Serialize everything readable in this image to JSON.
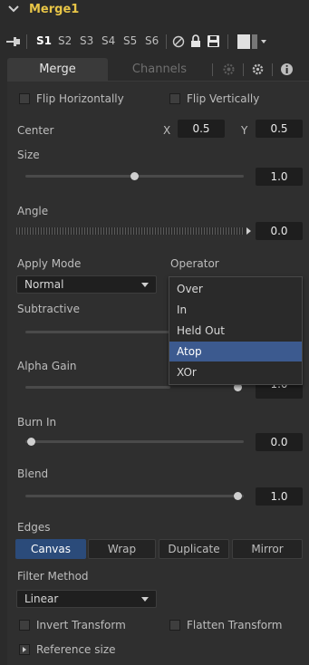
{
  "node": {
    "title": "Merge1"
  },
  "slots": {
    "items": [
      "S1",
      "S2",
      "S3",
      "S4",
      "S5",
      "S6"
    ],
    "active": "S1"
  },
  "tabs": {
    "merge": "Merge",
    "channels": "Channels"
  },
  "flip": {
    "horizontal": "Flip Horizontally",
    "vertical": "Flip Vertically"
  },
  "center": {
    "label": "Center",
    "x_label": "X",
    "x_value": "0.5",
    "y_label": "Y",
    "y_value": "0.5"
  },
  "size": {
    "label": "Size",
    "value": "1.0"
  },
  "angle": {
    "label": "Angle",
    "value": "0.0"
  },
  "apply_mode": {
    "label": "Apply Mode",
    "value": "Normal"
  },
  "operator": {
    "label": "Operator",
    "options": [
      "Over",
      "In",
      "Held Out",
      "Atop",
      "XOr"
    ],
    "highlighted": "Atop"
  },
  "subtractive": {
    "label": "Subtractive"
  },
  "alpha_gain": {
    "label": "Alpha Gain",
    "value": "1.0"
  },
  "burn_in": {
    "label": "Burn In",
    "value": "0.0"
  },
  "blend": {
    "label": "Blend",
    "value": "1.0"
  },
  "edges": {
    "label": "Edges",
    "options": [
      "Canvas",
      "Wrap",
      "Duplicate",
      "Mirror"
    ],
    "active": "Canvas"
  },
  "filter_method": {
    "label": "Filter Method",
    "value": "Linear"
  },
  "transform": {
    "invert": "Invert Transform",
    "flatten": "Flatten Transform"
  },
  "reference": {
    "label": "Reference size"
  },
  "colors": {
    "accent": "#e8c547",
    "selection": "#3c5a8f",
    "active_segment": "#2b4b7a",
    "background": "#2b2b2b"
  }
}
